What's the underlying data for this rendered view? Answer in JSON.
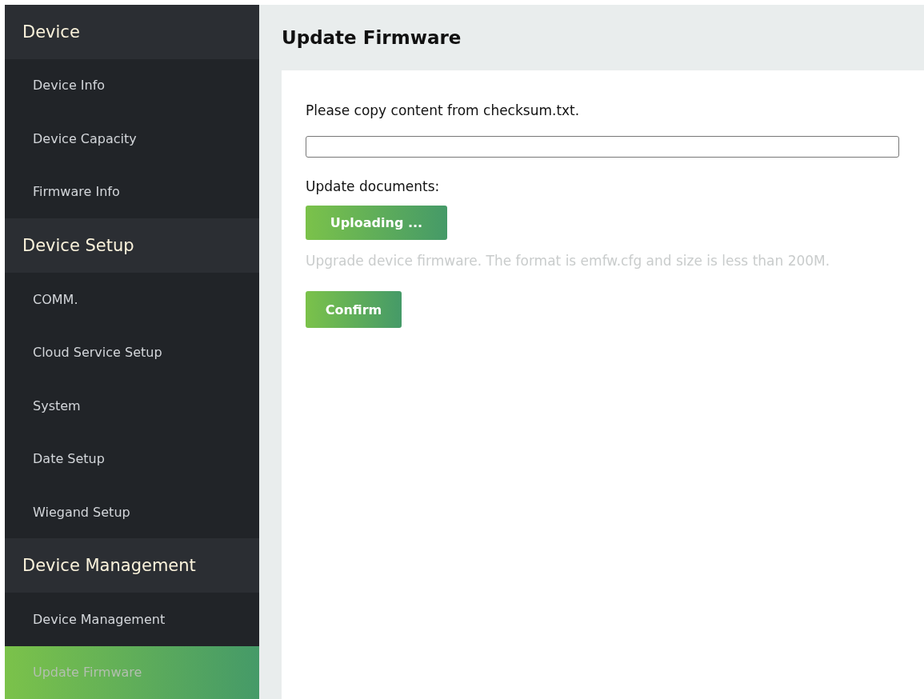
{
  "sidebar": {
    "groups": [
      {
        "title": "Device",
        "items": [
          {
            "label": "Device Info",
            "selected": false
          },
          {
            "label": "Device Capacity",
            "selected": false
          },
          {
            "label": "Firmware Info",
            "selected": false
          }
        ]
      },
      {
        "title": "Device Setup",
        "items": [
          {
            "label": "COMM.",
            "selected": false
          },
          {
            "label": "Cloud Service Setup",
            "selected": false
          },
          {
            "label": "System",
            "selected": false
          },
          {
            "label": "Date Setup",
            "selected": false
          },
          {
            "label": "Wiegand Setup",
            "selected": false
          }
        ]
      },
      {
        "title": "Device Management",
        "items": [
          {
            "label": "Device Management",
            "selected": false
          },
          {
            "label": "Update Firmware",
            "selected": true
          }
        ]
      }
    ]
  },
  "page_title": "Update Firmware",
  "form": {
    "checksum_label": "Please copy content from checksum.txt.",
    "documents_label": "Update documents:",
    "upload_button": "Uploading ...",
    "hint": "Upgrade device firmware. The format is emfw.cfg and size is less than 200M.",
    "confirm_button": "Confirm"
  }
}
